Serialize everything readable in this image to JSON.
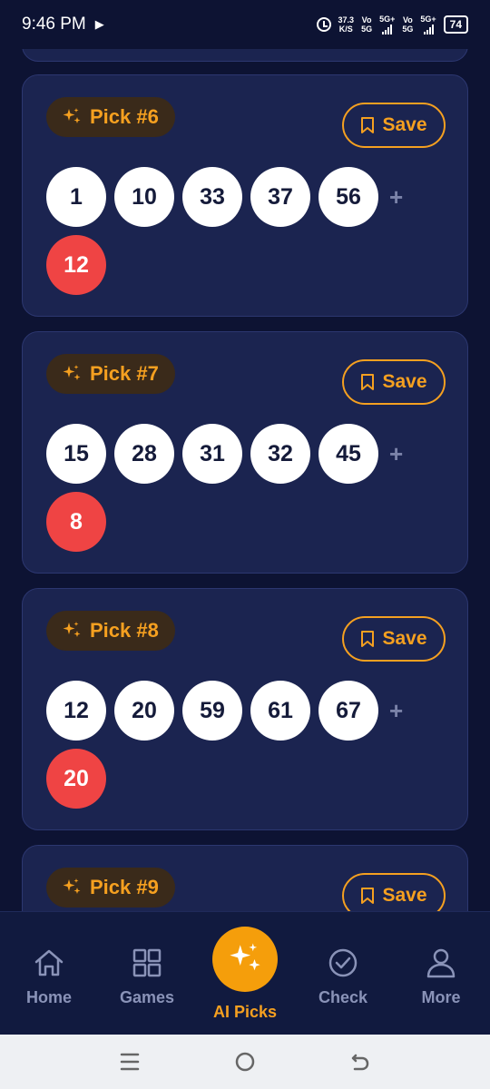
{
  "status_bar": {
    "time": "9:46 PM",
    "speed_value": "37.3",
    "speed_unit": "K/S",
    "net1_top": "Vo",
    "net1_bottom": "5G",
    "net1_type": "5G+",
    "net2_top": "Vo",
    "net2_bottom": "5G",
    "net2_type": "5G+",
    "battery": "74"
  },
  "colors": {
    "background": "#0d1333",
    "card": "#1b2450",
    "accent": "#f5a020",
    "bonus_ball": "#ef4444"
  },
  "picks": [
    {
      "label": "Pick #6",
      "save_label": "Save",
      "numbers": [
        "1",
        "10",
        "33",
        "37",
        "56"
      ],
      "plus": "+",
      "bonus": "12"
    },
    {
      "label": "Pick #7",
      "save_label": "Save",
      "numbers": [
        "15",
        "28",
        "31",
        "32",
        "45"
      ],
      "plus": "+",
      "bonus": "8"
    },
    {
      "label": "Pick #8",
      "save_label": "Save",
      "numbers": [
        "12",
        "20",
        "59",
        "61",
        "67"
      ],
      "plus": "+",
      "bonus": "20"
    },
    {
      "label": "Pick #9",
      "save_label": "Save"
    }
  ],
  "bottom_nav": {
    "items": [
      {
        "label": "Home",
        "icon": "home-icon"
      },
      {
        "label": "Games",
        "icon": "grid-icon"
      },
      {
        "label": "AI Picks",
        "icon": "sparkles-icon",
        "active": true
      },
      {
        "label": "Check",
        "icon": "check-circle-icon"
      },
      {
        "label": "More",
        "icon": "user-icon"
      }
    ]
  }
}
